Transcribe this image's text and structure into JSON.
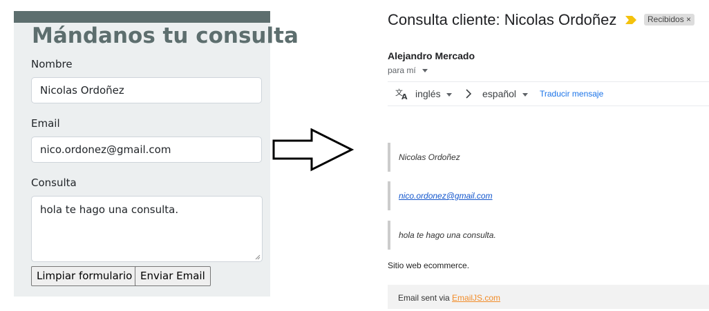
{
  "form": {
    "title": "Mándanos tu consulta",
    "name_label": "Nombre",
    "name_value": "Nicolas Ordoñez",
    "email_label": "Email",
    "email_value": "nico.ordonez@gmail.com",
    "query_label": "Consulta",
    "query_value": "hola te hago una consulta.",
    "clear_button": "Limpiar formulario",
    "send_button": "Enviar Email"
  },
  "email": {
    "subject": "Consulta cliente: Nicolas Ordoñez",
    "label_chip": "Recibidos ×",
    "sender": "Alejandro Mercado",
    "recipient": "para mí",
    "translate": {
      "from": "inglés",
      "to": "español",
      "link": "Traducir mensaje"
    },
    "quote_name": "Nicolas Ordoñez",
    "quote_email": "nico.ordonez@gmail.com",
    "quote_message": "hola te hago una consulta.",
    "footer": "Sitio web ecommerce.",
    "sent_via_prefix": "Email sent via ",
    "sent_via_link": "EmailJS.com"
  },
  "colors": {
    "form_bg": "#eceff0",
    "form_accent": "#5d6e6e",
    "importance_marker": "#f4c20d",
    "link": "#1a73e8",
    "emailjs_link": "#f28c28"
  },
  "icons": {
    "arrow": "right-arrow-outline-icon",
    "importance": "importance-marker-icon",
    "translate": "translate-icon"
  }
}
